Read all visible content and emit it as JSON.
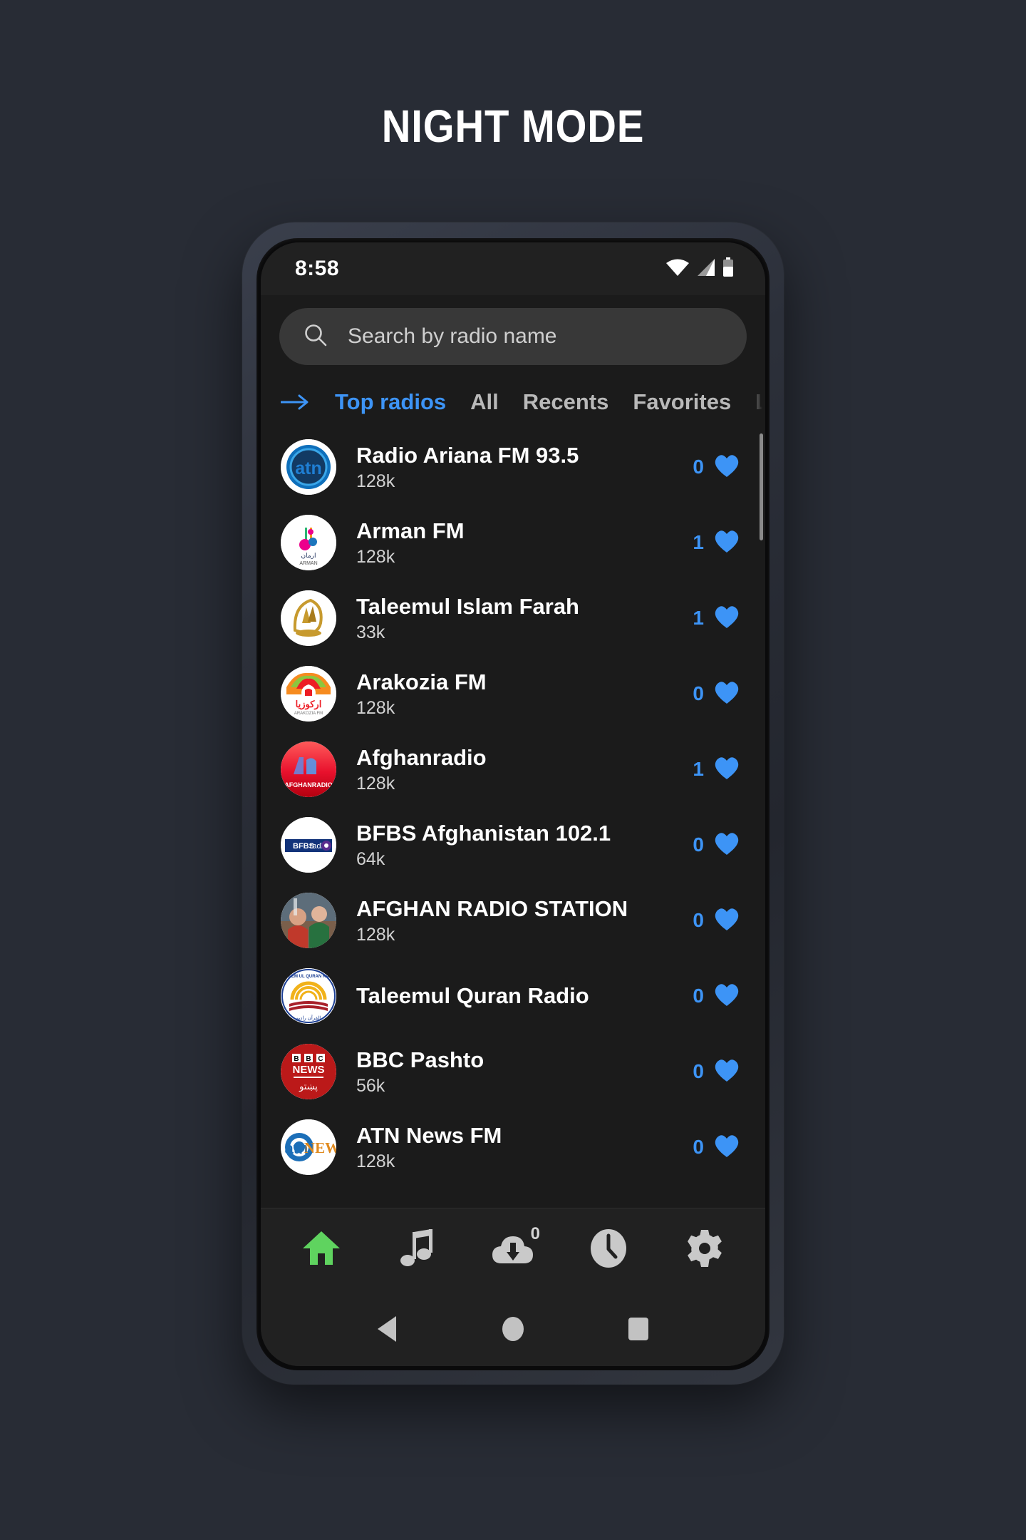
{
  "page": {
    "title": "NIGHT MODE",
    "backdrop_color": "#282c35"
  },
  "status_bar": {
    "time": "8:58",
    "icons": [
      "wifi-icon",
      "cellular-signal-icon",
      "battery-icon"
    ]
  },
  "search": {
    "placeholder": "Search by radio name",
    "icon": "search-icon"
  },
  "tabs": {
    "indicator_icon": "arrow-right-icon",
    "active": "Top radios",
    "accent_color": "#3d94f6",
    "items": [
      {
        "label": "Top radios",
        "active": true
      },
      {
        "label": "All",
        "active": false
      },
      {
        "label": "Recents",
        "active": false
      },
      {
        "label": "Favorites",
        "active": false
      },
      {
        "label": "Loc",
        "active": false
      }
    ]
  },
  "stations": [
    {
      "name": "Radio Ariana FM 93.5",
      "bitrate": "128k",
      "favorites": "0",
      "logo": "ariana"
    },
    {
      "name": "Arman FM",
      "bitrate": "128k",
      "favorites": "1",
      "logo": "arman"
    },
    {
      "name": "Taleemul Islam Farah",
      "bitrate": "33k",
      "favorites": "1",
      "logo": "taleemul-islam"
    },
    {
      "name": "Arakozia FM",
      "bitrate": "128k",
      "favorites": "0",
      "logo": "arakozia"
    },
    {
      "name": "Afghanradio",
      "bitrate": "128k",
      "favorites": "1",
      "logo": "afghanradio"
    },
    {
      "name": "BFBS Afghanistan 102.1",
      "bitrate": "64k",
      "favorites": "0",
      "logo": "bfbs"
    },
    {
      "name": "AFGHAN RADIO STATION",
      "bitrate": "128k",
      "favorites": "0",
      "logo": "afghan-radio-station"
    },
    {
      "name": "Taleemul Quran Radio",
      "bitrate": "",
      "favorites": "0",
      "logo": "taleemul-quran"
    },
    {
      "name": "BBC Pashto",
      "bitrate": "56k",
      "favorites": "0",
      "logo": "bbc-pashto"
    },
    {
      "name": "ATN News FM",
      "bitrate": "128k",
      "favorites": "0",
      "logo": "atn-news"
    }
  ],
  "bottom_nav": {
    "items": [
      {
        "icon": "home-icon",
        "active": true,
        "badge": ""
      },
      {
        "icon": "music-note-icon",
        "active": false,
        "badge": ""
      },
      {
        "icon": "cloud-download-icon",
        "active": false,
        "badge": "0"
      },
      {
        "icon": "clock-icon",
        "active": false,
        "badge": ""
      },
      {
        "icon": "gear-icon",
        "active": false,
        "badge": ""
      }
    ],
    "active_color": "#5fd35f",
    "inactive_color": "#c9c9c9"
  },
  "system_nav": {
    "items": [
      "back-icon",
      "home-circle-icon",
      "recents-square-icon"
    ]
  }
}
